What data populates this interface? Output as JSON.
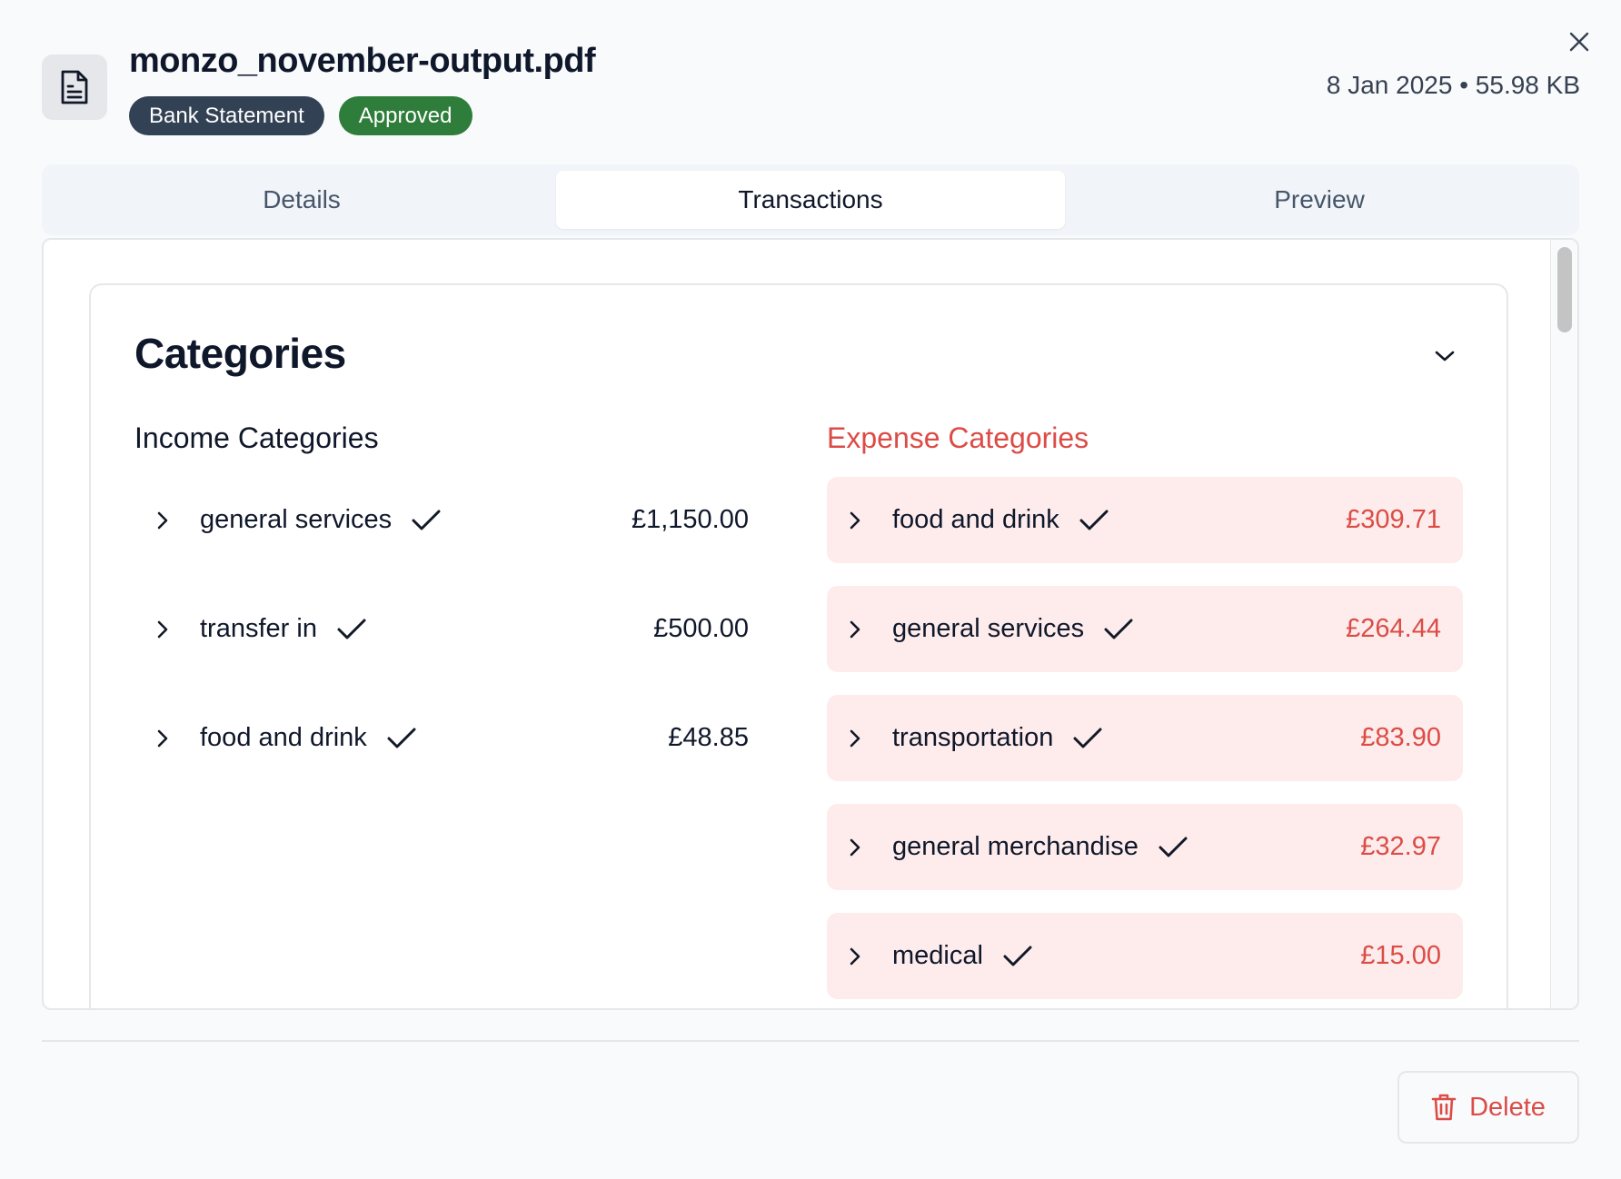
{
  "header": {
    "file_name": "monzo_november-output.pdf",
    "badges": [
      {
        "label": "Bank Statement",
        "color": "#334155"
      },
      {
        "label": "Approved",
        "color": "#2e7d3a"
      }
    ],
    "meta": "8 Jan 2025 • 55.98 KB",
    "icons": {
      "file": "document-icon",
      "close": "close-icon"
    }
  },
  "tabs": [
    {
      "label": "Details",
      "active": false
    },
    {
      "label": "Transactions",
      "active": true
    },
    {
      "label": "Preview",
      "active": false
    }
  ],
  "categories": {
    "title": "Categories",
    "income": {
      "title": "Income Categories",
      "items": [
        {
          "name": "general services",
          "amount": "£1,150.00",
          "approved": true
        },
        {
          "name": "transfer in",
          "amount": "£500.00",
          "approved": true
        },
        {
          "name": "food and drink",
          "amount": "£48.85",
          "approved": true
        }
      ]
    },
    "expense": {
      "title": "Expense Categories",
      "color": "#dc4c46",
      "row_background": "#fdeceb",
      "items": [
        {
          "name": "food and drink",
          "amount": "£309.71",
          "approved": true
        },
        {
          "name": "general services",
          "amount": "£264.44",
          "approved": true
        },
        {
          "name": "transportation",
          "amount": "£83.90",
          "approved": true
        },
        {
          "name": "general merchandise",
          "amount": "£32.97",
          "approved": true
        },
        {
          "name": "medical",
          "amount": "£15.00",
          "approved": true
        }
      ]
    }
  },
  "footer": {
    "delete_label": "Delete",
    "delete_icon": "trash-icon"
  }
}
